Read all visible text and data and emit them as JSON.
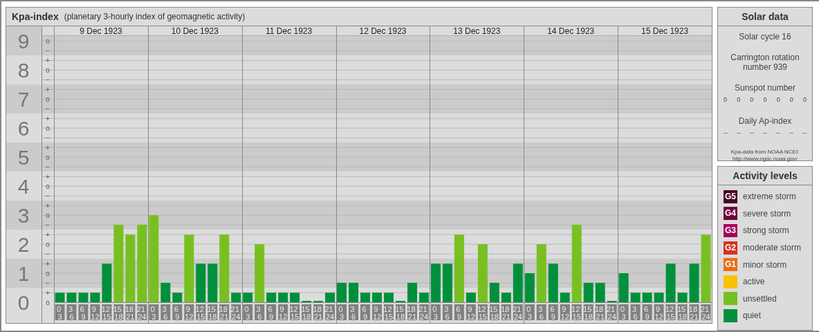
{
  "kpa_panel": {
    "title": "Kpa-index",
    "subtitle": "(planetary 3-hourly index of geomagnetic activity)",
    "days": [
      "9 Dec 1923",
      "10 Dec 1923",
      "11 Dec 1923",
      "12 Dec 1923",
      "13 Dec 1923",
      "14 Dec 1923",
      "15 Dec 1923"
    ],
    "chart_data": {
      "type": "bar",
      "grid": true,
      "ylim": [
        0,
        9.2
      ],
      "categories": [
        "0 3",
        "3 6",
        "6 9",
        "9 12",
        "12 15",
        "15 18",
        "18 21",
        "21 24",
        "0 3",
        "3 6",
        "6 9",
        "9 12",
        "12 15",
        "15 18",
        "18 21",
        "21 24",
        "0 3",
        "3 6",
        "6 9",
        "9 12",
        "12 15",
        "15 18",
        "18 21",
        "21 24",
        "0 3",
        "3 6",
        "6 9",
        "9 12",
        "12 15",
        "15 18",
        "18 21",
        "21 24",
        "0 3",
        "3 6",
        "6 9",
        "9 12",
        "12 15",
        "15 18",
        "18 21",
        "21 24",
        "0 3",
        "3 6",
        "6 9",
        "9 12",
        "12 15",
        "15 18",
        "18 21",
        "21 24",
        "0 3",
        "3 6",
        "6 9",
        "9 12",
        "12 15",
        "15 18",
        "18 21",
        "21 24"
      ],
      "series": [
        {
          "color": "#00903c",
          "values": [
            0.33,
            0.33,
            0.33,
            0.33,
            1.33,
            null,
            null,
            null,
            null,
            0.67,
            0.33,
            null,
            1.33,
            1.33,
            null,
            0.33,
            0.33,
            null,
            0.33,
            0.33,
            0.33,
            0,
            0,
            0.33,
            0.67,
            0.67,
            0.33,
            0.33,
            0.33,
            0,
            0.67,
            0.33,
            1.33,
            1.33,
            null,
            0.33,
            null,
            0.67,
            0.33,
            1.33,
            1,
            null,
            1.33,
            0.33,
            null,
            0.67,
            0.67,
            0,
            1,
            0.33,
            0.33,
            0.33,
            1.33,
            0.33,
            1.33,
            null
          ]
        },
        {
          "color": "#78c021",
          "values": [
            null,
            null,
            null,
            null,
            null,
            2.67,
            2.33,
            2.67,
            3,
            null,
            null,
            2.33,
            null,
            null,
            2.33,
            null,
            null,
            2,
            null,
            null,
            null,
            null,
            null,
            null,
            null,
            null,
            null,
            null,
            null,
            null,
            null,
            null,
            null,
            null,
            2.33,
            null,
            2,
            null,
            null,
            null,
            null,
            2,
            null,
            null,
            2.67,
            null,
            null,
            null,
            null,
            null,
            null,
            null,
            null,
            null,
            null,
            2.33
          ]
        }
      ],
      "yticks": [
        9,
        8,
        7,
        6,
        5,
        4,
        3,
        2,
        1,
        0
      ]
    },
    "minor_tick_labels": [
      "o",
      "−",
      "+",
      "o",
      "−",
      "+",
      "o",
      "−",
      "+",
      "o",
      "−",
      "+",
      "o",
      "−",
      "+",
      "o",
      "−",
      "+",
      "o",
      "−",
      "+",
      "o",
      "−",
      "+",
      "o",
      "−",
      "+",
      "o"
    ]
  },
  "solar_data": {
    "title": "Solar data",
    "solar_cycle": "Solar cycle 16",
    "carrington_rotation": "Carrington rotation number 939",
    "sunspot_label": "Sunspot number",
    "sunspot_numbers": [
      "0",
      "0",
      "0",
      "0",
      "0",
      "0",
      "0"
    ],
    "ap_label": "Daily Ap-index",
    "ap_values": [
      "--",
      "--",
      "--",
      "--",
      "--",
      "--",
      "--"
    ],
    "source": "Kpa-data from NOAA NCEI:",
    "source_url": "http://www.ngdc.noaa.gov/"
  },
  "activity_levels": {
    "title": "Activity levels",
    "items": [
      {
        "badge": "G5",
        "label": "extreme storm",
        "color": "#4a0020"
      },
      {
        "badge": "G4",
        "label": "severe storm",
        "color": "#6e0040"
      },
      {
        "badge": "G3",
        "label": "strong storm",
        "color": "#a5005c"
      },
      {
        "badge": "G2",
        "label": "moderate storm",
        "color": "#d8301f"
      },
      {
        "badge": "G1",
        "label": "minor storm",
        "color": "#e67014"
      },
      {
        "label": "active",
        "color": "#f8c200"
      },
      {
        "label": "unsettled",
        "color": "#78c021"
      },
      {
        "label": "quiet",
        "color": "#00903c"
      }
    ]
  }
}
